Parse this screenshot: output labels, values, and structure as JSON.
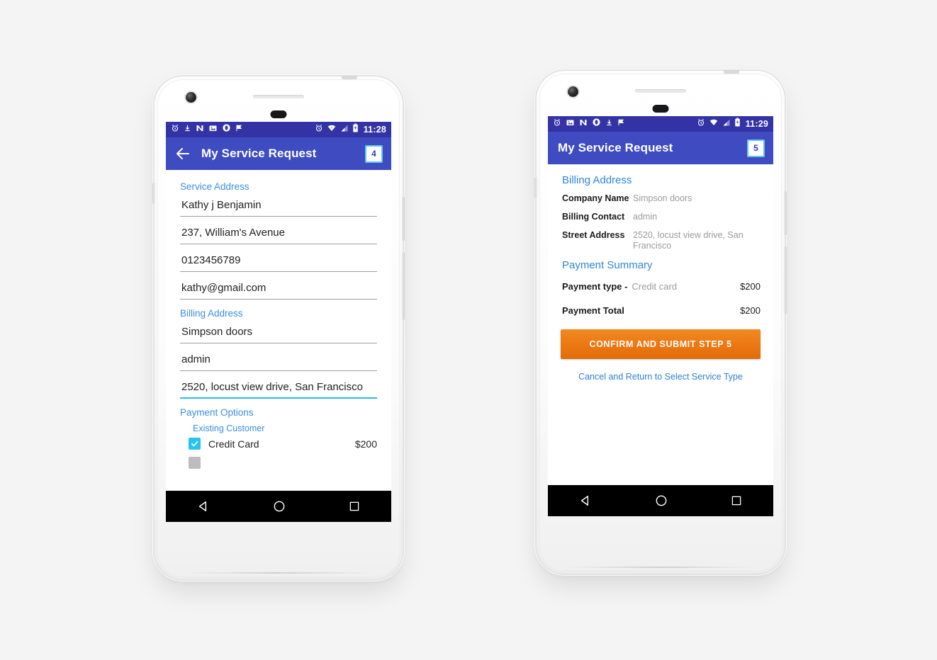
{
  "phones": [
    {
      "id": "phone-step-4",
      "statusbar": {
        "left_icons": [
          "alarm-icon",
          "download-icon",
          "news-icon",
          "photos-icon",
          "opera-icon",
          "flag-icon"
        ],
        "right_icons": [
          "alarm-icon",
          "wifi-icon",
          "signal-icon",
          "battery-icon"
        ],
        "time": "11:28"
      },
      "appbar": {
        "back_icon": "back-arrow-icon",
        "title": "My Service Request",
        "step_badge": "4"
      },
      "form": {
        "service_address_label": "Service Address",
        "service_fields": [
          {
            "name": "contact-name",
            "value": "Kathy j Benjamin"
          },
          {
            "name": "street-address",
            "value": "237, William's Avenue"
          },
          {
            "name": "phone-number",
            "value": "0123456789"
          },
          {
            "name": "email-address",
            "value": "kathy@gmail.com"
          }
        ],
        "billing_address_label": "Billing Address",
        "billing_fields": [
          {
            "name": "company-name",
            "value": "Simpson doors"
          },
          {
            "name": "billing-contact",
            "value": "admin"
          },
          {
            "name": "billing-street-address",
            "value": "2520, locust view drive, San Francisco"
          }
        ],
        "payment_options_label": "Payment Options",
        "existing_customer_label": "Existing Customer",
        "payment_rows": [
          {
            "label": "Credit Card",
            "price": "$200",
            "checked": true
          }
        ]
      }
    },
    {
      "id": "phone-step-5",
      "statusbar": {
        "left_icons": [
          "alarm-icon",
          "photos-icon",
          "news-icon",
          "opera-icon",
          "download-icon",
          "flag-icon"
        ],
        "right_icons": [
          "alarm-icon",
          "wifi-icon",
          "signal-icon",
          "battery-icon"
        ],
        "time": "11:29"
      },
      "appbar": {
        "title": "My Service Request",
        "step_badge": "5"
      },
      "summary": {
        "billing_address_label": "Billing Address",
        "billing_rows": [
          {
            "key": "Company Name",
            "value": "Simpson doors"
          },
          {
            "key": "Billing Contact",
            "value": "admin"
          },
          {
            "key": "Street Address",
            "value": "2520, locust view drive, San Francisco"
          }
        ],
        "payment_summary_label": "Payment Summary",
        "payment_type_key": "Payment type -",
        "payment_type_value": "Credit card",
        "payment_type_amount": "$200",
        "payment_total_key": "Payment Total",
        "payment_total_amount": "$200",
        "submit_button": "CONFIRM AND SUBMIT STEP 5",
        "cancel_link": "Cancel and Return to Select Service Type"
      }
    }
  ],
  "navbar": {
    "back": "nav-back-icon",
    "home": "nav-home-icon",
    "recents": "nav-recents-icon"
  },
  "colors": {
    "statusbar": "#3333a6",
    "appbar": "#3f4bc0",
    "link": "#3b8ede",
    "accent_checkbox": "#29c3ef",
    "submit_button": "#ec7712",
    "focused_underline": "#2bbbe0",
    "page_background": "#f4f4f4"
  }
}
